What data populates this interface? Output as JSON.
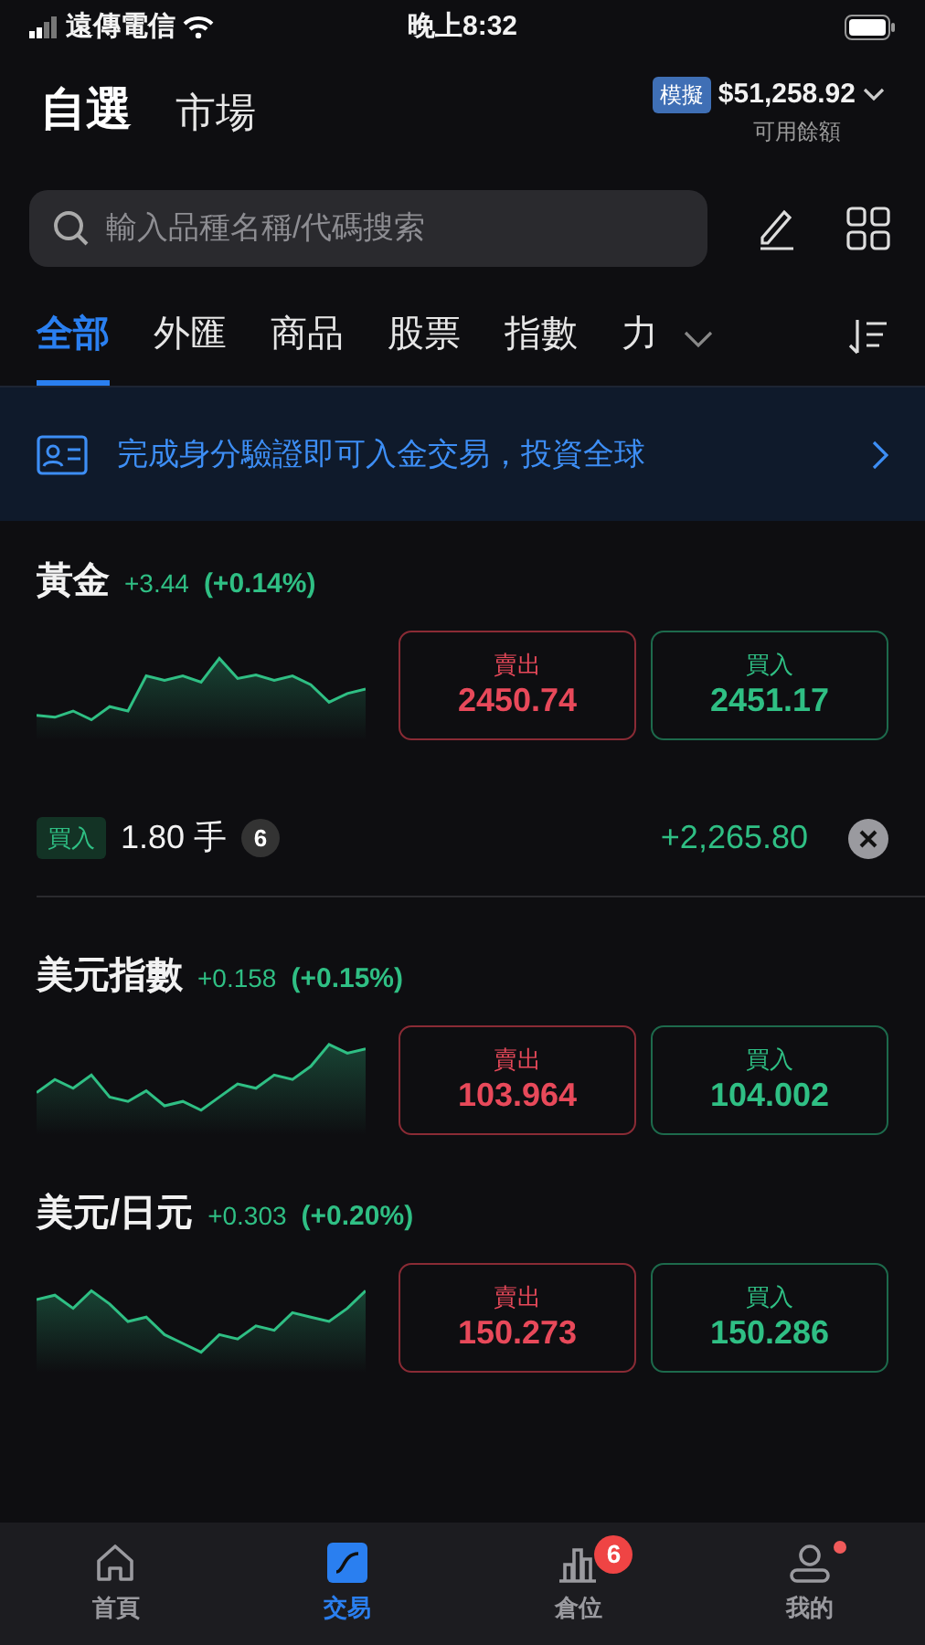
{
  "status_bar": {
    "carrier": "遠傳電信",
    "time": "晚上8:32"
  },
  "header": {
    "tabs": [
      {
        "label": "自選",
        "selected": true
      },
      {
        "label": "市場",
        "selected": false
      }
    ],
    "account": {
      "badge": "模擬",
      "balance": "$51,258.92",
      "caption": "可用餘額"
    }
  },
  "search": {
    "placeholder": "輸入品種名稱/代碼搜索"
  },
  "categories": [
    {
      "label": "全部",
      "selected": true
    },
    {
      "label": "外匯",
      "selected": false
    },
    {
      "label": "商品",
      "selected": false
    },
    {
      "label": "股票",
      "selected": false
    },
    {
      "label": "指數",
      "selected": false
    },
    {
      "label": "力",
      "selected": false
    }
  ],
  "banner": {
    "text": "完成身分驗證即可入金交易，投資全球"
  },
  "instruments": [
    {
      "name": "黃金",
      "change": "+3.44",
      "change_pct": "(+0.14%)",
      "sell_label": "賣出",
      "sell": "2450.74",
      "buy_label": "買入",
      "buy": "2451.17",
      "position": {
        "side": "買入",
        "lots": "1.80 手",
        "count": "6",
        "pnl": "+2,265.80"
      }
    },
    {
      "name": "美元指數",
      "change": "+0.158",
      "change_pct": "(+0.15%)",
      "sell_label": "賣出",
      "sell": "103.964",
      "buy_label": "買入",
      "buy": "104.002"
    },
    {
      "name": "美元/日元",
      "change": "+0.303",
      "change_pct": "(+0.20%)",
      "sell_label": "賣出",
      "sell": "150.273",
      "buy_label": "買入",
      "buy": "150.286"
    }
  ],
  "bottom_nav": [
    {
      "label": "首頁",
      "selected": false
    },
    {
      "label": "交易",
      "selected": true
    },
    {
      "label": "倉位",
      "selected": false,
      "badge": "6"
    },
    {
      "label": "我的",
      "selected": false,
      "dot": true
    }
  ]
}
